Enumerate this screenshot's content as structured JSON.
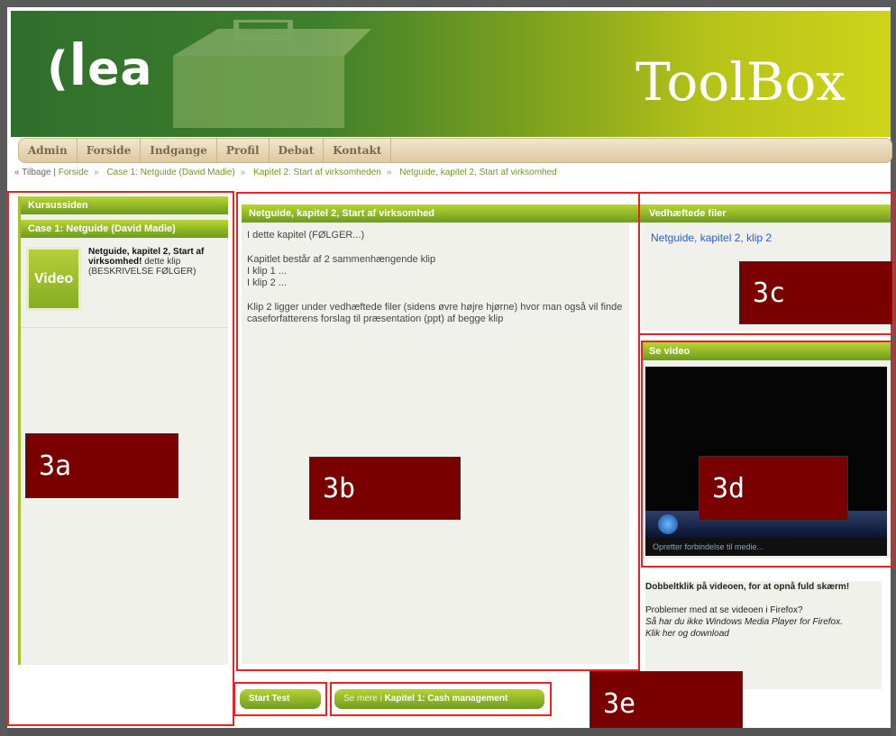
{
  "header": {
    "logo": "(ꟾea",
    "brand": "ToolBox"
  },
  "nav": {
    "items": [
      "Admin",
      "Forside",
      "Indgange",
      "Profil",
      "Debat",
      "Kontakt"
    ]
  },
  "breadcrumb": {
    "back": "« Tilbage |",
    "items": [
      "Forside",
      "Case 1: Netguide (David Madie)",
      "Kapitel 2: Start af virksomheden",
      "Netguide, kapitel 2, Start af virksomhed"
    ]
  },
  "left": {
    "title": "Kursussiden",
    "subtitle": "Case 1: Netguide (David Madie)",
    "video_badge": "Video",
    "video_title": "Netguide, kapitel 2, Start af virksomhed!",
    "video_desc": " dette klip (BESKRIVELSE FØLGER)"
  },
  "main": {
    "title": "Netguide, kapitel 2, Start af virksomhed",
    "p1": "I dette kapitel (FØLGER...)",
    "p2a": "Kapitlet består af 2 sammenhængende klip",
    "p2b": "I klip 1 ...",
    "p2c": "I klip 2 ...",
    "p3": "Klip 2 ligger under vedhæftede filer (sidens øvre højre hjørne) hvor man også vil finde caseforfatterens forslag til præsentation (ppt) af begge klip"
  },
  "files": {
    "title": "Vedhæftede filer",
    "link": "Netguide, kapitel 2, klip 2"
  },
  "video": {
    "title": "Se video",
    "status": "Opretter forbindelse til medie..."
  },
  "note": {
    "bold": "Dobbeltklik på videoen, for at opnå fuld skærm!",
    "line1": "Problemer med at se videoen i Firefox?",
    "line2": "Så har du ikke Windows Media Player for Firefox.",
    "line3": "Klik her og download"
  },
  "buttons": {
    "start": "Start Test",
    "more_prefix": "Se mere i ",
    "more_bold": "Kapitel 1: Cash management"
  },
  "labels": {
    "a": "3a",
    "b": "3b",
    "c": "3c",
    "d": "3d",
    "e": "3e"
  }
}
